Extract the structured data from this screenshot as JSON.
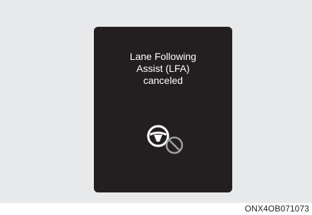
{
  "display": {
    "message_lines": [
      "Lane Following",
      "Assist (LFA)",
      "canceled"
    ],
    "icon": "steering-wheel-canceled-icon"
  },
  "caption": "ONX4OB071073",
  "colors": {
    "screen_background": "#231f20",
    "figure_background": "#e8e9ea",
    "text": "#ffffff",
    "icon_canceled_ring": "#9d9fa2"
  }
}
